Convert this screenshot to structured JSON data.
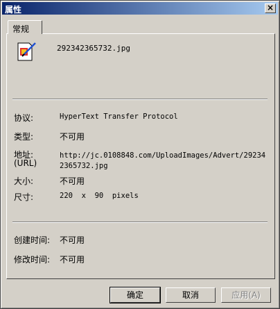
{
  "window": {
    "title": "属性",
    "close_glyph": "×"
  },
  "tab": {
    "label": "常规"
  },
  "file": {
    "icon": "image-file-icon",
    "name": "292342365732.jpg"
  },
  "properties": {
    "protocol": {
      "label": "协议:",
      "value": "HyperText Transfer Protocol"
    },
    "type": {
      "label": "类型:",
      "value": "不可用"
    },
    "address": {
      "label": "地址:",
      "label_sub": "(URL)",
      "value_line1": "http://jc.0108848.com/UploadImages/Advert/29234",
      "value_line2": "2365732.jpg"
    },
    "size": {
      "label": "大小:",
      "value": "不可用"
    },
    "dimensions": {
      "label": "尺寸:",
      "value": "220  x  90  pixels"
    },
    "created": {
      "label": "创建时间:",
      "value": "不可用"
    },
    "modified": {
      "label": "修改时间:",
      "value": "不可用"
    }
  },
  "buttons": {
    "ok": "确定",
    "cancel": "取消",
    "apply": "应用(A)"
  }
}
